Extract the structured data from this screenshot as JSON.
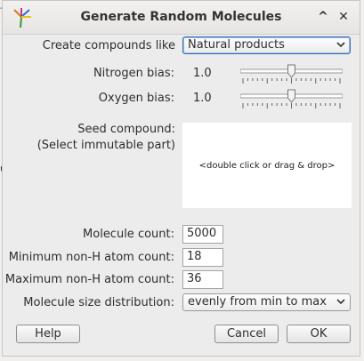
{
  "edge": {
    "top": "-",
    "mid": "u"
  },
  "window": {
    "title": "Generate Random Molecules",
    "minimize_glyph": "^",
    "close_glyph": "✕"
  },
  "form": {
    "compounds": {
      "label": "Create compounds like",
      "value": "Natural products"
    },
    "nitrogen": {
      "label": "Nitrogen bias:",
      "value": "1.0",
      "level": 0.5
    },
    "oxygen": {
      "label": "Oxygen bias:",
      "value": "1.0",
      "level": 0.5
    },
    "seed": {
      "label_line1": "Seed compound:",
      "label_line2": "(Select immutable part)",
      "placeholder": "<double click or drag & drop>"
    },
    "molecule_count": {
      "label": "Molecule count:",
      "value": "5000"
    },
    "min_atoms": {
      "label": "Minimum non-H atom count:",
      "value": "18"
    },
    "max_atoms": {
      "label": "Maximum non-H atom count:",
      "value": "36"
    },
    "distribution": {
      "label": "Molecule size distribution:",
      "value": "evenly from min to max"
    }
  },
  "buttons": {
    "help": "Help",
    "cancel": "Cancel",
    "ok": "OK"
  }
}
